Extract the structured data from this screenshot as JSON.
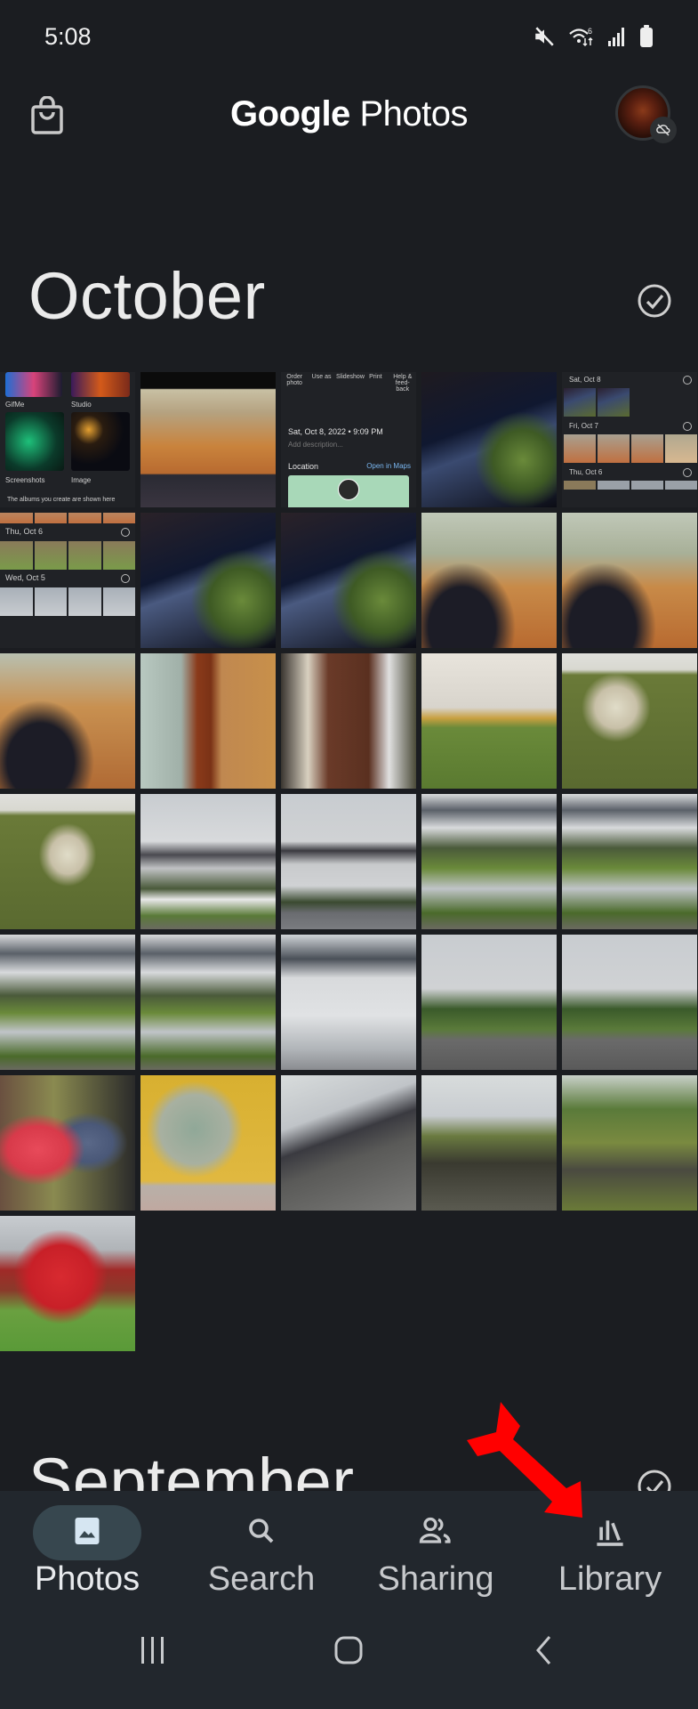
{
  "status_bar": {
    "time": "5:08",
    "icons": [
      "mute-icon",
      "wifi-6-icon",
      "signal-icon",
      "battery-icon"
    ]
  },
  "app_bar": {
    "logo_google": "Google",
    "logo_photos": "Photos",
    "left_icon": "shopping-bag-icon",
    "avatar_badge": "backup-off-icon"
  },
  "sections": [
    {
      "month": "October",
      "select_icon": "check-circle-icon"
    },
    {
      "month": "September",
      "select_icon": "check-circle-icon"
    }
  ],
  "thumbnails": {
    "library_screenshot": {
      "albums": [
        "GifMe",
        "Studio",
        "Screenshots",
        "Image"
      ],
      "note": "The albums you create are shown here",
      "days": [
        "Fri, Oct 7",
        "Thu, Oct 6",
        "Wed, Oct 5"
      ]
    },
    "info_screenshot": {
      "actions": [
        "Order photo",
        "Use as",
        "Slideshow",
        "Print",
        "Help & feed-back"
      ],
      "date": "Sat, Oct 8, 2022 • 9:09 PM",
      "description_placeholder": "Add description...",
      "location_label": "Location",
      "open_maps": "Open in Maps"
    },
    "days_screenshot": {
      "days": [
        "Sat, Oct 8",
        "Fri, Oct 7",
        "Thu, Oct 6"
      ]
    }
  },
  "photos": [
    {
      "desc": "Google Photos library screenshot"
    },
    {
      "desc": "Cats on wooden floor by window"
    },
    {
      "desc": "Photo info panel screenshot"
    },
    {
      "desc": "Night balcony with tree and clouds"
    },
    {
      "desc": "Day list screenshot"
    },
    {
      "desc": "Night balcony with tree"
    },
    {
      "desc": "Night balcony with tree"
    },
    {
      "desc": "Cat on wooden floor"
    },
    {
      "desc": "Cat on wooden floor"
    },
    {
      "desc": "Cats on wooden floor with rug"
    },
    {
      "desc": "Cat lying in sunlight by curtain"
    },
    {
      "desc": "Front door with Halloween skeletons"
    },
    {
      "desc": "House with Halloween yard decorations"
    },
    {
      "desc": "Skeleton emerging from ground"
    },
    {
      "desc": "Skeleton emerging from ground"
    },
    {
      "desc": "Foggy mountain above house"
    },
    {
      "desc": "Foggy mountain peak"
    },
    {
      "desc": "Mountain with low clouds and houses"
    },
    {
      "desc": "Mountain with low clouds and houses"
    },
    {
      "desc": "Mountain with low clouds and houses"
    },
    {
      "desc": "Mountain with low clouds and houses"
    },
    {
      "desc": "Mountain in fog"
    },
    {
      "desc": "Road with evergreen tree"
    },
    {
      "desc": "Road with evergreen tree"
    },
    {
      "desc": "Hats in window"
    },
    {
      "desc": "Town map mural on yellow wall"
    },
    {
      "desc": "Old train car"
    },
    {
      "desc": "Fence and path with industrial chimney"
    },
    {
      "desc": "Overgrown path with trees"
    },
    {
      "desc": "Red autumn trees on lawn"
    }
  ],
  "bottom_nav": {
    "items": [
      {
        "label": "Photos",
        "icon": "photo-icon",
        "active": true
      },
      {
        "label": "Search",
        "icon": "search-icon",
        "active": false
      },
      {
        "label": "Sharing",
        "icon": "people-icon",
        "active": false
      },
      {
        "label": "Library",
        "icon": "library-icon",
        "active": false
      }
    ]
  },
  "system_nav": [
    "recents-icon",
    "home-icon",
    "back-icon"
  ],
  "annotation": {
    "type": "red-arrow",
    "target": "Library",
    "color": "#ff0000"
  }
}
